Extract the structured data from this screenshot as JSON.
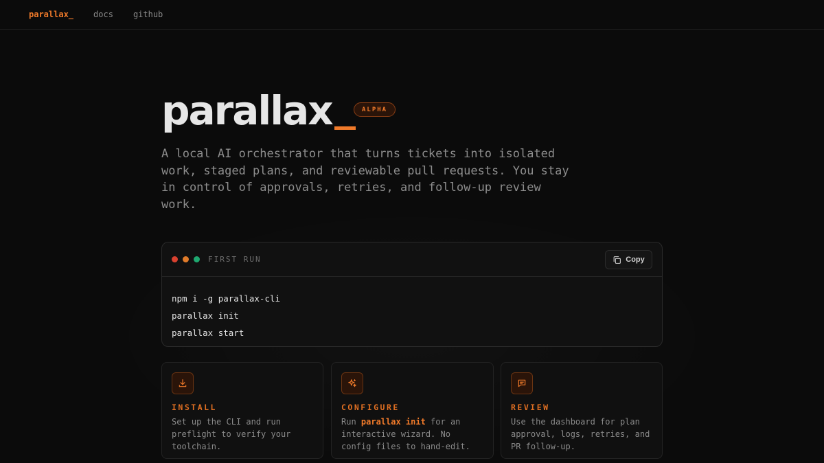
{
  "nav": {
    "brand": "parallax_",
    "links": [
      "docs",
      "github"
    ]
  },
  "hero": {
    "title": "parallax",
    "badge": "ALPHA",
    "tagline": "A local AI orchestrator that turns tickets into isolated work, staged plans, and reviewable pull requests. You stay in control of approvals, retries, and follow-up review work."
  },
  "terminal": {
    "title": "FIRST RUN",
    "copy_label": "Copy",
    "dots": [
      "#d9412f",
      "#e07b2a",
      "#1fa870"
    ],
    "commands": [
      "npm i -g parallax-cli",
      "parallax init",
      "parallax start"
    ]
  },
  "cards": [
    {
      "icon": "download-icon",
      "title": "INSTALL",
      "lines": [
        "Set up the CLI and run",
        "preflight to verify your",
        "toolchain."
      ]
    },
    {
      "icon": "sparkle-icon",
      "title": "CONFIGURE",
      "line1_pre": "Run ",
      "line1_code": "parallax init",
      "line1_post": " for an",
      "lines": [
        "interactive wizard. No",
        "config files to hand-edit."
      ]
    },
    {
      "icon": "message-icon",
      "title": "REVIEW",
      "lines": [
        "Use the dashboard for plan",
        "approval, logs, retries, and",
        "PR follow-up."
      ]
    }
  ],
  "colors": {
    "accent": "#f07a2a",
    "background": "#0b0b0b"
  }
}
